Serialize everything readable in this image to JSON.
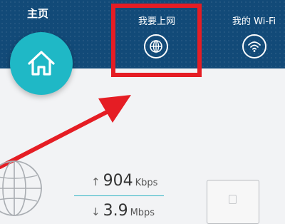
{
  "nav": {
    "home_label": "主页",
    "internet_label": "我要上网",
    "wifi_label": "我的 Wi-Fi"
  },
  "stats": {
    "upload": {
      "arrow": "↑",
      "value": "904",
      "unit": "Kbps"
    },
    "download": {
      "arrow": "↓",
      "value": "3.9",
      "unit": "Mbps"
    }
  },
  "icons": {
    "home": "home-icon",
    "internet": "globe-icon",
    "wifi": "wifi-icon",
    "router": "router-icon"
  },
  "colors": {
    "header": "#124a78",
    "accent": "#1fb8c6",
    "highlight": "#e51d24",
    "background": "#f2f3f5"
  }
}
